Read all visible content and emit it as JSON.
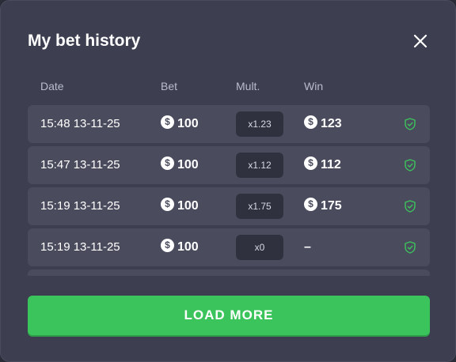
{
  "modal": {
    "title": "My bet history",
    "close_icon": "close-icon"
  },
  "columns": {
    "date": "Date",
    "bet": "Bet",
    "mult": "Mult.",
    "win": "Win"
  },
  "rows": [
    {
      "date": "15:48 13-11-25",
      "bet": "100",
      "mult": "x1.23",
      "win": "123"
    },
    {
      "date": "15:47 13-11-25",
      "bet": "100",
      "mult": "x1.12",
      "win": "112"
    },
    {
      "date": "15:19 13-11-25",
      "bet": "100",
      "mult": "x1.75",
      "win": "175"
    },
    {
      "date": "15:19 13-11-25",
      "bet": "100",
      "mult": "x0",
      "win": "–"
    },
    {
      "date": "",
      "bet": "",
      "mult": "",
      "win": ""
    }
  ],
  "coin_symbol": "$",
  "icons": {
    "coin": "dollar-coin-icon",
    "verify": "shield-check-icon"
  },
  "colors": {
    "modal_bg": "#3d3f50",
    "row_bg": "#4a4c5e",
    "pill_bg": "#2f313f",
    "accent_green": "#3cc45c",
    "shield_green": "#3cc45c"
  },
  "load_more_label": "LOAD MORE"
}
